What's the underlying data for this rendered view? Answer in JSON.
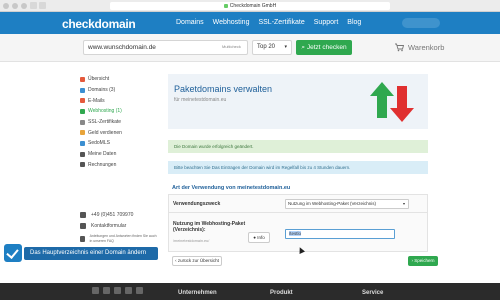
{
  "browser": {
    "url": "Checkdomain GmbH"
  },
  "header": {
    "logo": "checkdomain",
    "nav": [
      "Domains",
      "Webhosting",
      "SSL-Zertifikate",
      "Support",
      "Blog"
    ],
    "account": "Account"
  },
  "search": {
    "value": "www.wunschdomain.de",
    "multicheck": "Multicheck",
    "tld": "Top 20",
    "button": "Jetzt checken",
    "cart": "Warenkorb",
    "cart_count": "0"
  },
  "sidebar": {
    "items": [
      {
        "label": "Übersicht",
        "color": "#e55a3c"
      },
      {
        "label": "Domains (3)",
        "color": "#3b8fd1"
      },
      {
        "label": "E-Mails",
        "color": "#e55a3c"
      },
      {
        "label": "Webhosting (1)",
        "color": "#2fa84f"
      },
      {
        "label": "SSL-Zertifikate",
        "color": "#888888"
      },
      {
        "label": "Geld verdienen",
        "color": "#e8a43a"
      },
      {
        "label": "SedoMLS",
        "color": "#3b8fd1"
      },
      {
        "label": "Meine Daten",
        "color": "#555555"
      },
      {
        "label": "Rechnungen",
        "color": "#555555"
      }
    ],
    "phone": "+49 (0)451 709970",
    "contact_form": "Kontaktformular",
    "faq_text": "Anleitungen und Antworten finden Sie auch in unseren FAQ"
  },
  "main": {
    "title": "Paketdomains verwalten",
    "subtitle": "für meinetestdomain.eu",
    "success_msg": "Die Domain wurde erfolgreich geändert.",
    "info_msg": "Bitte beachten Sie Das Eintragen der Domain wird im Regelfall bis zu 4 Stunden dauern.",
    "section_title": "Art der Verwendung von meinetestdomain.eu",
    "usage_label": "Verwendungszweck",
    "usage_value": "Nutzung im Webhosting-Paket (Verzeichnis)",
    "dir_label": "Nutzung im Webhosting-Paket (Verzeichnis):",
    "dir_hint": "/meinetestdomain.eu/",
    "dir_value": "/testlo",
    "info_button": "Info",
    "back_button": "zurück zur Übersicht",
    "save_button": "Speichern"
  },
  "footer": {
    "cols": [
      "Unternehmen",
      "Produkt",
      "Service"
    ]
  },
  "caption": {
    "text": "Das Hauptverzeichnis einer Domain ändern"
  }
}
